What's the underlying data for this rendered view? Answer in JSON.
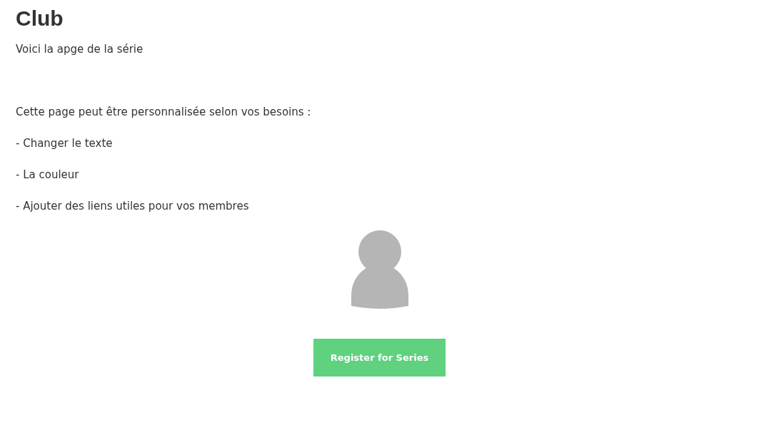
{
  "title": "Club",
  "intro": "Voici la apge de la série",
  "paragraphs": [
    "Cette page peut être personnalisée selon vos besoins :",
    "- Changer le texte",
    "- La couleur",
    "- Ajouter des liens utiles pour vos membres"
  ],
  "button": {
    "label": "Register for Series"
  }
}
